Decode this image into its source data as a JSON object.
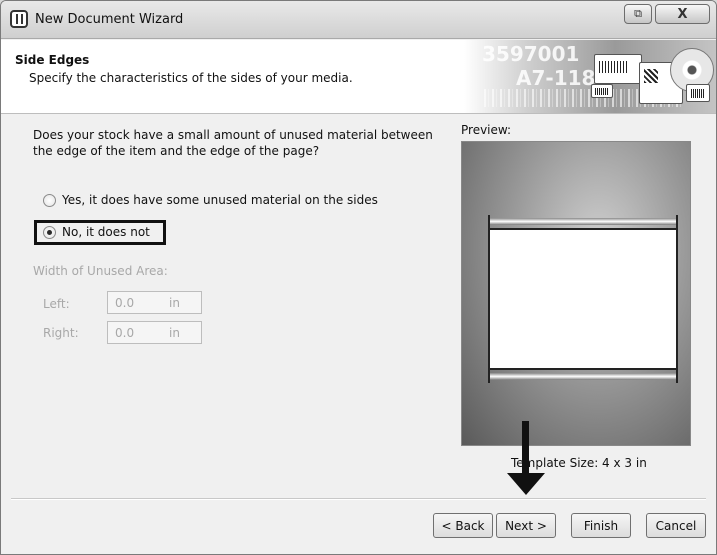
{
  "window": {
    "title": "New Document Wizard",
    "restore_glyph": "⧉",
    "close_glyph": "X"
  },
  "header": {
    "title": "Side Edges",
    "subtitle": "Specify the characteristics of the sides of your media.",
    "banner_text_1": "3597001",
    "banner_text_2": "A7-118"
  },
  "question": "Does your stock have a small amount of unused material between the edge of the item and the edge of the page?",
  "options": [
    {
      "label": "Yes, it does have some unused material on the sides",
      "selected": false
    },
    {
      "label": "No, it does not",
      "selected": true
    }
  ],
  "unused_area": {
    "heading": "Width of Unused Area:",
    "left": {
      "label": "Left:",
      "value": "0.0",
      "unit": "in"
    },
    "right": {
      "label": "Right:",
      "value": "0.0",
      "unit": "in"
    }
  },
  "preview": {
    "label": "Preview:",
    "template_size": "Template Size:  4 x 3 in"
  },
  "buttons": {
    "back": "< Back",
    "next": "Next >",
    "finish": "Finish",
    "cancel": "Cancel"
  }
}
